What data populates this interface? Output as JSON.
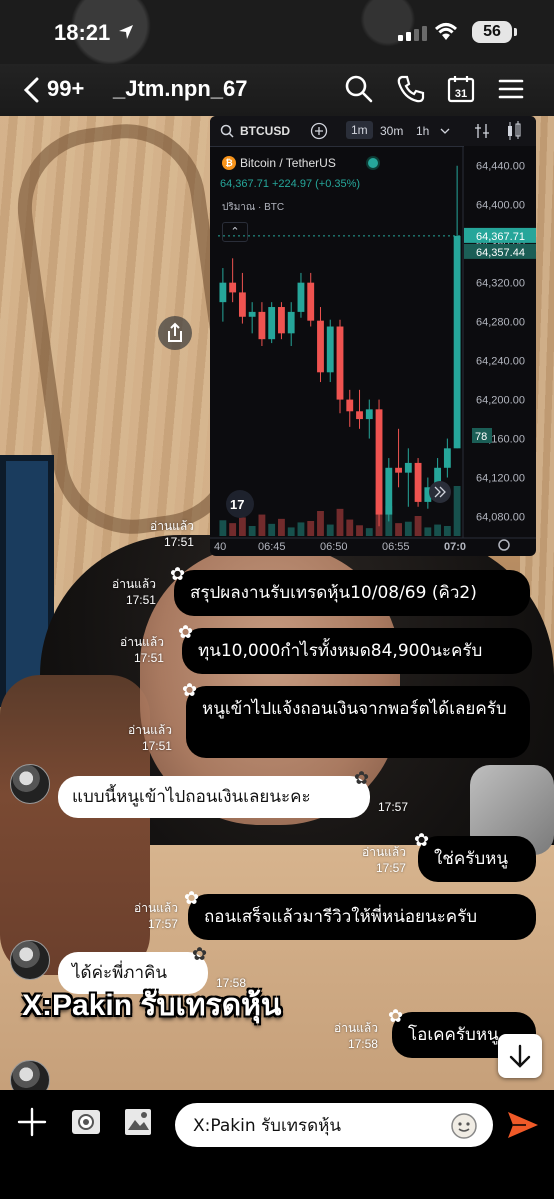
{
  "status_bar": {
    "time": "18:21",
    "battery": "56"
  },
  "header": {
    "unread_count": "99+",
    "chat_name": "_Jtm.npn_67",
    "calendar_day": "31"
  },
  "chart_card": {
    "symbol": "BTCUSD",
    "timeframes": [
      "1m",
      "30m",
      "1h"
    ],
    "active_timeframe": "1m",
    "pair_name": "Bitcoin / TetherUS",
    "quote": "64,367.71  +224.97 (+0.35%)",
    "volume_label": "ปริมาณ · BTC",
    "last_price_tag": "64,367.71",
    "bid_price_tag": "64,357.44",
    "volume_tag": "78",
    "price_labels": [
      "64,440.00",
      "64,400.00",
      "64,360.00",
      "64,320.00",
      "64,280.00",
      "64,240.00",
      "64,200.00",
      "64,160.00",
      "64,120.00",
      "64,080.00"
    ],
    "time_labels": [
      "40",
      "06:45",
      "06:50",
      "06:55",
      "07:0"
    ],
    "colors": {
      "up": "#26a69a",
      "down": "#ef5350",
      "bg": "#0c0c0f"
    }
  },
  "chart_data": {
    "type": "candlestick",
    "ylim": [
      64060,
      64450
    ],
    "y_ticks": [
      64440,
      64400,
      64360,
      64320,
      64280,
      64240,
      64200,
      64160,
      64120,
      64080
    ],
    "candles": [
      {
        "o": 64300,
        "h": 64335,
        "l": 64280,
        "c": 64320,
        "v": 22
      },
      {
        "o": 64320,
        "h": 64345,
        "l": 64300,
        "c": 64310,
        "v": 18
      },
      {
        "o": 64310,
        "h": 64330,
        "l": 64278,
        "c": 64285,
        "v": 26
      },
      {
        "o": 64285,
        "h": 64300,
        "l": 64268,
        "c": 64290,
        "v": 14
      },
      {
        "o": 64290,
        "h": 64300,
        "l": 64255,
        "c": 64262,
        "v": 30
      },
      {
        "o": 64262,
        "h": 64300,
        "l": 64258,
        "c": 64295,
        "v": 17
      },
      {
        "o": 64295,
        "h": 64300,
        "l": 64262,
        "c": 64268,
        "v": 24
      },
      {
        "o": 64268,
        "h": 64300,
        "l": 64255,
        "c": 64290,
        "v": 12
      },
      {
        "o": 64290,
        "h": 64330,
        "l": 64284,
        "c": 64320,
        "v": 19
      },
      {
        "o": 64320,
        "h": 64330,
        "l": 64275,
        "c": 64281,
        "v": 21
      },
      {
        "o": 64281,
        "h": 64295,
        "l": 64218,
        "c": 64228,
        "v": 35
      },
      {
        "o": 64228,
        "h": 64282,
        "l": 64218,
        "c": 64275,
        "v": 16
      },
      {
        "o": 64275,
        "h": 64282,
        "l": 64186,
        "c": 64200,
        "v": 38
      },
      {
        "o": 64200,
        "h": 64210,
        "l": 64172,
        "c": 64188,
        "v": 23
      },
      {
        "o": 64188,
        "h": 64210,
        "l": 64170,
        "c": 64180,
        "v": 15
      },
      {
        "o": 64180,
        "h": 64200,
        "l": 64160,
        "c": 64190,
        "v": 11
      },
      {
        "o": 64190,
        "h": 64200,
        "l": 64070,
        "c": 64082,
        "v": 65
      },
      {
        "o": 64082,
        "h": 64140,
        "l": 64075,
        "c": 64130,
        "v": 42
      },
      {
        "o": 64130,
        "h": 64170,
        "l": 64110,
        "c": 64125,
        "v": 18
      },
      {
        "o": 64125,
        "h": 64150,
        "l": 64090,
        "c": 64135,
        "v": 20
      },
      {
        "o": 64135,
        "h": 64140,
        "l": 64090,
        "c": 64095,
        "v": 28
      },
      {
        "o": 64095,
        "h": 64120,
        "l": 64088,
        "c": 64110,
        "v": 12
      },
      {
        "o": 64110,
        "h": 64140,
        "l": 64100,
        "c": 64130,
        "v": 16
      },
      {
        "o": 64130,
        "h": 64160,
        "l": 64120,
        "c": 64150,
        "v": 14
      },
      {
        "o": 64150,
        "h": 64440,
        "l": 64150,
        "c": 64368,
        "v": 70
      }
    ]
  },
  "messages": [
    {
      "read": "อ่านแล้ว",
      "time": "17:51"
    },
    {
      "read": "อ่านแล้ว",
      "time": "17:51",
      "text": "สรุปผลงานรับเทรดหุ้น10/08/69 (คิว2)"
    },
    {
      "read": "อ่านแล้ว",
      "time": "17:51",
      "text": "ทุน10,000กำไรทั้งหมด84,900นะครับ"
    },
    {
      "read": "อ่านแล้ว",
      "time": "17:51",
      "text": "หนูเข้าไปแจ้งถอนเงินจากพอร์ตได้เลยครับ"
    },
    {
      "time": "17:57",
      "text": "แบบนี้หนูเข้าไปถอนเงินเลยนะคะ"
    },
    {
      "read": "อ่านแล้ว",
      "time": "17:57",
      "text": "ใช่ครับหนู"
    },
    {
      "read": "อ่านแล้ว",
      "time": "17:57",
      "text": "ถอนเสร็จแล้วมารีวิวให้พี่หน่อยนะครับ"
    },
    {
      "time": "17:58",
      "text": "ได้ค่ะพี่ภาคิน"
    },
    {
      "read": "อ่านแล้ว",
      "time": "17:58",
      "text": "โอเคครับหนู"
    }
  ],
  "overlay_caption": "X:Pakin รับเทรดหุ้น",
  "input": {
    "value": "X:Pakin รับเทรดหุ้น"
  },
  "accent_send": "#f05a28"
}
